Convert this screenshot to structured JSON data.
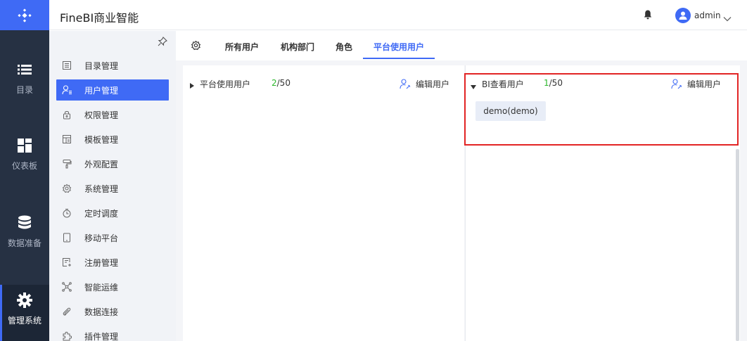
{
  "app": {
    "title": "FineBI商业智能"
  },
  "user": {
    "name": "admin"
  },
  "nav": {
    "items": [
      {
        "label": "目录",
        "icon": "list-icon"
      },
      {
        "label": "仪表板",
        "icon": "dashboard-icon"
      },
      {
        "label": "数据准备",
        "icon": "database-icon"
      },
      {
        "label": "管理系统",
        "icon": "gear-icon",
        "active": true
      }
    ]
  },
  "sidebar": {
    "items": [
      {
        "label": "目录管理",
        "icon": "catalog-icon"
      },
      {
        "label": "用户管理",
        "icon": "user-manage-icon",
        "active": true
      },
      {
        "label": "权限管理",
        "icon": "lock-icon"
      },
      {
        "label": "模板管理",
        "icon": "template-icon"
      },
      {
        "label": "外观配置",
        "icon": "paint-roller-icon"
      },
      {
        "label": "系统管理",
        "icon": "settings-icon"
      },
      {
        "label": "定时调度",
        "icon": "timer-icon"
      },
      {
        "label": "移动平台",
        "icon": "mobile-icon"
      },
      {
        "label": "注册管理",
        "icon": "register-icon"
      },
      {
        "label": "智能运维",
        "icon": "ops-icon"
      },
      {
        "label": "数据连接",
        "icon": "link-icon"
      },
      {
        "label": "插件管理",
        "icon": "plugin-icon"
      }
    ]
  },
  "tabs": {
    "items": [
      {
        "label": "所有用户"
      },
      {
        "label": "机构部门"
      },
      {
        "label": "角色"
      },
      {
        "label": "平台使用用户",
        "active": true
      }
    ]
  },
  "left_panel": {
    "title": "平台使用用户",
    "count_used": "2",
    "count_total": "/50",
    "edit_label": "编辑用户"
  },
  "right_panel": {
    "title": "BI查看用户",
    "count_used": "1",
    "count_total": "/50",
    "edit_label": "编辑用户",
    "users": [
      "demo(demo)"
    ]
  },
  "colors": {
    "accent": "#3f6af5",
    "nav_bg": "#263143",
    "count_green": "#2cb82c",
    "highlight_red": "#e22424"
  }
}
